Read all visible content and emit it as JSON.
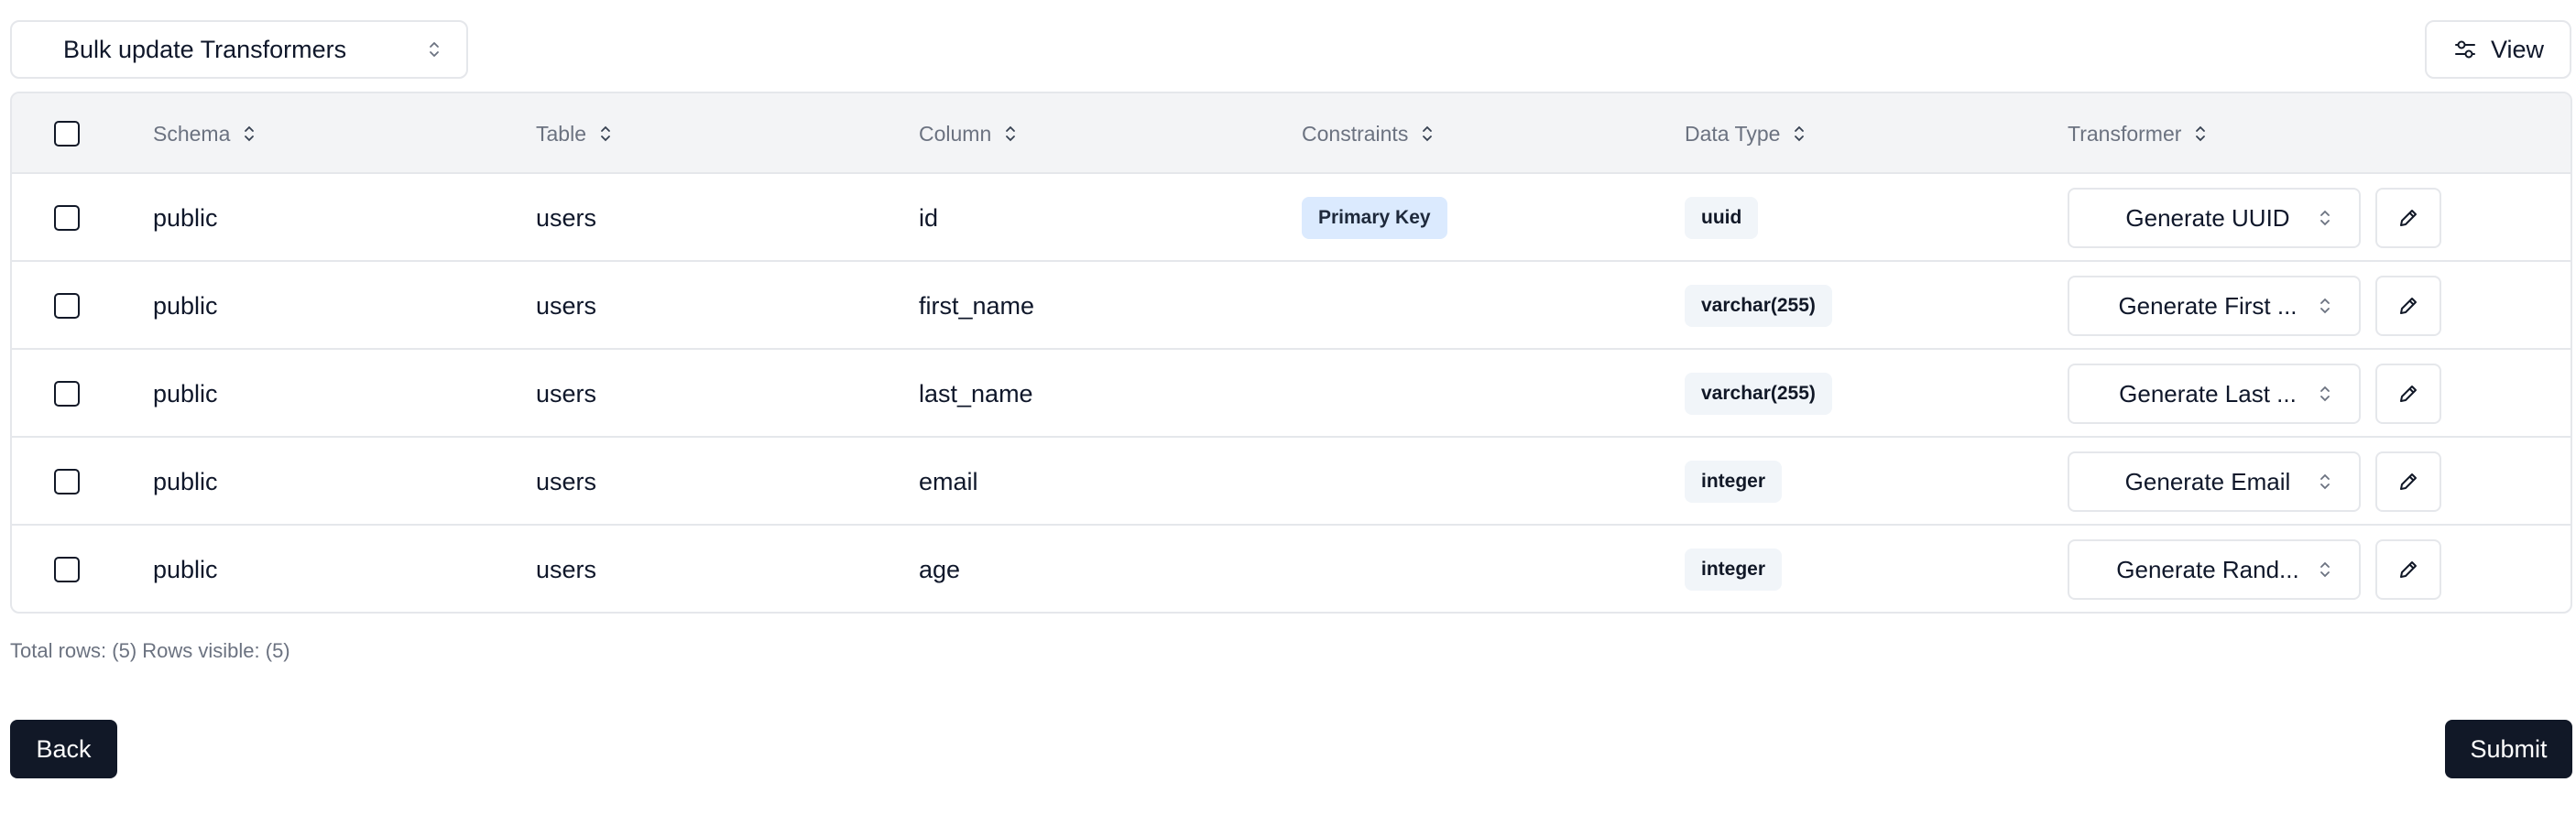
{
  "toolbar": {
    "bulk_select_label": "Bulk update Transformers",
    "view_label": "View"
  },
  "table": {
    "headers": [
      "Schema",
      "Table",
      "Column",
      "Constraints",
      "Data Type",
      "Transformer"
    ],
    "rows": [
      {
        "schema": "public",
        "table": "users",
        "column": "id",
        "constraint": "Primary Key",
        "data_type": "uuid",
        "transformer": "Generate UUID"
      },
      {
        "schema": "public",
        "table": "users",
        "column": "first_name",
        "constraint": "",
        "data_type": "varchar(255)",
        "transformer": "Generate First ..."
      },
      {
        "schema": "public",
        "table": "users",
        "column": "last_name",
        "constraint": "",
        "data_type": "varchar(255)",
        "transformer": "Generate Last ..."
      },
      {
        "schema": "public",
        "table": "users",
        "column": "email",
        "constraint": "",
        "data_type": "integer",
        "transformer": "Generate Email"
      },
      {
        "schema": "public",
        "table": "users",
        "column": "age",
        "constraint": "",
        "data_type": "integer",
        "transformer": "Generate Rand..."
      }
    ]
  },
  "footer": {
    "summary": "Total rows: (5) Rows visible: (5)",
    "back_label": "Back",
    "submit_label": "Submit"
  },
  "colors": {
    "primary": "#111827",
    "header_bg": "#f3f4f6",
    "border": "#e5e7eb",
    "pk_badge": "#dbeafe",
    "type_badge": "#f1f5f9"
  }
}
